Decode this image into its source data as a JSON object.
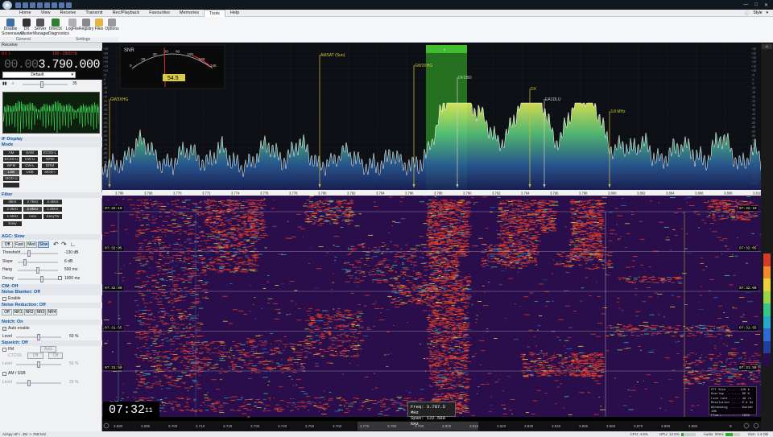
{
  "menu": [
    "Home",
    "View",
    "Receive",
    "Transmit",
    "Rec/Playback",
    "Favourites",
    "Memories",
    "Tools",
    "Help"
  ],
  "menu_active": "Tools",
  "menu_right": [
    "Style"
  ],
  "ribbon": {
    "buttons": [
      {
        "label": "Disable Screensaver",
        "icon": "monitor-icon",
        "color": "#3a6ea5"
      },
      {
        "label": "DX Cluster",
        "icon": "dx-icon",
        "color": "#333"
      },
      {
        "label": "Server Manager",
        "icon": "server-icon",
        "color": "#555"
      },
      {
        "label": "DirectX Diagnostics",
        "icon": "directx-icon",
        "color": "#2f7d2f"
      },
      {
        "label": "LogFile",
        "icon": "logfile-icon",
        "color": "#b0b0b0"
      },
      {
        "label": "Registry",
        "icon": "registry-icon",
        "color": "#888"
      },
      {
        "label": "Files",
        "icon": "folder-icon",
        "color": "#e2b640"
      },
      {
        "label": "Options",
        "icon": "gear-icon",
        "color": "#999"
      }
    ],
    "groups": [
      "General",
      "Settings"
    ]
  },
  "left": {
    "receive_header": "Receive",
    "vfo_label": "RX 1",
    "vfo_bw": "100 - 2900 Hz",
    "freq_dim": "00.00",
    "freq_bright": "3.790.000",
    "profile": "Default",
    "volume": "35",
    "if_display": "IF Display",
    "mode_header": "Mode",
    "modes": [
      "AM",
      "SAM",
      "ECSS-L",
      "ECSS-U",
      "CW-U",
      "NFM",
      "WFM",
      "CW-L",
      "DRM",
      "LSB",
      "USB",
      "MOD-I",
      "MOD-U"
    ],
    "mode_selected": "LSB",
    "filter_header": "Filter",
    "filters": [
      "3kHz",
      "2.7kHz",
      "2.4kHz",
      "2.3kHz",
      "2.8kHz",
      "1.8kHz",
      "1.5kHz",
      "Auto",
      "EasyTw",
      "Easy"
    ],
    "filter_selected": "2.8kHz",
    "agc_header": "AGC: Slow",
    "agc_buttons": [
      "Off",
      "Fast",
      "Med",
      "Slow"
    ],
    "agc_selected": "Slow",
    "agc_rows": [
      {
        "label": "Threshold",
        "value": "-130 dB",
        "level": 0.25
      },
      {
        "label": "Slope",
        "value": "6 dB",
        "level": 0.15
      },
      {
        "label": "Hang",
        "value": "500 ms",
        "level": 0.5
      },
      {
        "label": "Decay",
        "value": "1000 ms",
        "level": 0.6
      }
    ],
    "cw_header": "CW: Off",
    "nb_header": "Noise Blanker: Off",
    "nb_enable": "Enable",
    "nr_header": "Noise Reduction: Off",
    "nr_buttons": [
      "Off",
      "NR1",
      "NR2",
      "NR3",
      "NR4"
    ],
    "notch_header": "Notch: On",
    "notch_auto": "Auto enable",
    "notch_level_label": "Level",
    "notch_level": "50 %",
    "squelch_header": "Squelch: Off",
    "sq_fm": "FM",
    "sq_auto": "Auto",
    "sq_ctcss": "CTCSS",
    "sq_off1": "Off",
    "sq_off2": "Off",
    "sq_level_label": "Level",
    "sq_level": "50 %",
    "sq_amssb": "AM / SSB",
    "sq_level2": "25 %"
  },
  "spectrum": {
    "smeter_label": "SNR",
    "smeter_scale": [
      "0",
      "20",
      "40",
      "60",
      "80",
      "100",
      "120",
      "140"
    ],
    "snr_value": "54.5",
    "markers": [
      {
        "label": "GW3XHG",
        "freq": 3.7655
      },
      {
        "label": "AMSAT (Sun)",
        "freq": 3.78
      },
      {
        "label": "GW3XHG",
        "freq": 3.7865
      },
      {
        "label": "DF2BO",
        "freq": 3.7895
      },
      {
        "label": "DX",
        "freq": 3.7945
      },
      {
        "label": "EA1DLU",
        "freq": 3.7955
      },
      {
        "label": "3.8 MHz",
        "freq": 3.8
      }
    ],
    "filter_top_label": "LSB",
    "x_ticks": [
      "3.766",
      "3.768",
      "3.770",
      "3.772",
      "3.774",
      "3.776",
      "3.778",
      "3.780",
      "3.782",
      "3.784",
      "3.786",
      "3.788",
      "3.790",
      "3.792",
      "3.794",
      "3.796",
      "3.798",
      "3.800",
      "3.802",
      "3.804",
      "3.806",
      "3.808",
      "3.810"
    ],
    "y_ticks": [
      "+35",
      "+30",
      "+25",
      "+20",
      "+15",
      "+10",
      "+5",
      "-0",
      "-5",
      "-10",
      "-15",
      "-20",
      "-25",
      "-30",
      "-35",
      "-40",
      "-45",
      "-50",
      "-55",
      "-60",
      "-65",
      "-70",
      "-75",
      "-80",
      "-85",
      "-90",
      "-95",
      "-100",
      "-105",
      "-110",
      "-115",
      "-120"
    ],
    "left_db": "-120 dB",
    "right_db": "-120 dB"
  },
  "waterfall": {
    "timestamps": [
      "07:32:10",
      "07:32:05",
      "07:32:00",
      "07:31:55",
      "07:31:50"
    ],
    "clock_main": "07:32",
    "clock_sec": "11",
    "tooltip_freq": "Freq: 3.787.5 MHz",
    "tooltip_span": "Span: 122.500 kHz",
    "info": [
      "FFT Size ...... 128 k",
      "Overlap ........ 85 %",
      "Line rate ...... 48 /s",
      "Resolution ..... 5.4 Hz",
      "Windowing ...... Kaiser 10B",
      "Flow ........... CUDA"
    ],
    "overview_ticks": [
      "3.680",
      "3.690",
      "3.700",
      "3.710",
      "3.720",
      "3.730",
      "3.740",
      "3.750",
      "3.760",
      "3.770",
      "3.780",
      "3.790",
      "3.800",
      "3.810",
      "3.820",
      "3.830",
      "3.840",
      "3.850",
      "3.860",
      "3.870",
      "3.880",
      "3.890"
    ]
  },
  "status": {
    "left": "Airspy HF+, 3M -> 768 kHz",
    "cpu": "CPU: 4.5%",
    "gpu": "GPU: 12.6%",
    "audio": "Audio: 30ms",
    "size": "Size: 1.4 GB"
  },
  "colors": {
    "accent": "#0b57a6",
    "filter_green": "#38c12a",
    "marker_yellow": "#e0d040"
  }
}
